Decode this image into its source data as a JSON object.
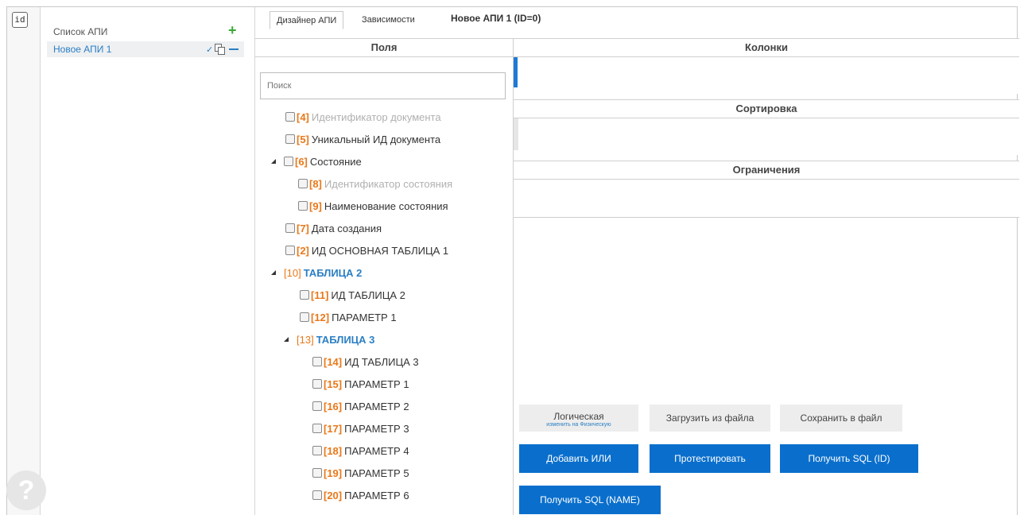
{
  "rail": {
    "id_label": "id",
    "help_label": "?"
  },
  "api_list": {
    "header": "Список АПИ",
    "add_icon": "+",
    "items": [
      {
        "label": "Новое АПИ 1"
      }
    ]
  },
  "tabs": [
    {
      "label": "Дизайнер АПИ",
      "active": true
    },
    {
      "label": "Зависимости",
      "active": false
    }
  ],
  "api_title": "Новое АПИ 1 (ID=0)",
  "fields": {
    "header": "Поля",
    "search_placeholder": "Поиск",
    "nodes": [
      {
        "num": "[4]",
        "label": "Идентификатор документа",
        "dim": true
      },
      {
        "num": "[5]",
        "label": "Уникальный ИД документа",
        "dim": false
      },
      {
        "num": "[6]",
        "label": "Состояние",
        "dim": false
      },
      {
        "num": "[8]",
        "label": "Идентификатор состояния",
        "dim": true
      },
      {
        "num": "[9]",
        "label": "Наименование состояния",
        "dim": false
      },
      {
        "num": "[7]",
        "label": "Дата создания",
        "dim": false
      },
      {
        "num": "[2]",
        "label": "ИД ОСНОВНАЯ ТАБЛИЦА 1",
        "dim": false
      },
      {
        "num": "[10]",
        "label": "ТАБЛИЦА 2",
        "group": true
      },
      {
        "num": "[11]",
        "label": "ИД ТАБЛИЦА 2",
        "dim": false
      },
      {
        "num": "[12]",
        "label": "ПАРАМЕТР 1",
        "dim": false
      },
      {
        "num": "[13]",
        "label": "ТАБЛИЦА 3",
        "group": true
      },
      {
        "num": "[14]",
        "label": "ИД ТАБЛИЦА 3",
        "dim": false
      },
      {
        "num": "[15]",
        "label": "ПАРАМЕТР 1",
        "dim": false
      },
      {
        "num": "[16]",
        "label": "ПАРАМЕТР 2",
        "dim": false
      },
      {
        "num": "[17]",
        "label": "ПАРАМЕТР 3",
        "dim": false
      },
      {
        "num": "[18]",
        "label": "ПАРАМЕТР 4",
        "dim": false
      },
      {
        "num": "[19]",
        "label": "ПАРАМЕТР 5",
        "dim": false
      },
      {
        "num": "[20]",
        "label": "ПАРАМЕТР 6",
        "dim": false
      }
    ]
  },
  "right": {
    "columns_header": "Колонки",
    "sort_header": "Сортировка",
    "limits_header": "Ограничения"
  },
  "buttons": {
    "logical": "Логическая",
    "logical_sub": "изменить на Физическую",
    "load_file": "Загрузить из файла",
    "save_file": "Сохранить в файл",
    "add_or": "Добавить ИЛИ",
    "test": "Протестировать",
    "get_sql_id": "Получить SQL (ID)",
    "get_sql_name": "Получить SQL (NAME)"
  },
  "colors": {
    "accent": "#0a6fcc",
    "orange": "#e8781a",
    "group_blue": "#2b7fc4",
    "add_green": "#3aaa35"
  }
}
